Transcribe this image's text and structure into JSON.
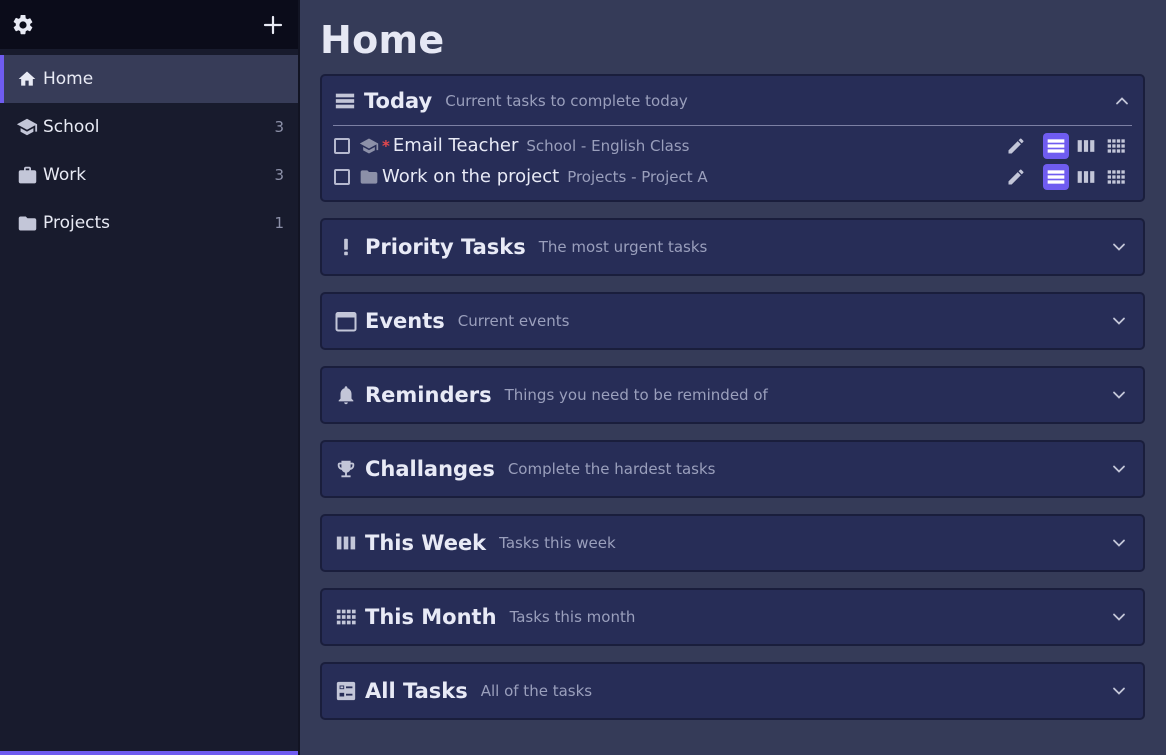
{
  "sidebar": {
    "items": [
      {
        "label": "Home",
        "count": ""
      },
      {
        "label": "School",
        "count": "3"
      },
      {
        "label": "Work",
        "count": "3"
      },
      {
        "label": "Projects",
        "count": "1"
      }
    ]
  },
  "main": {
    "title": "Home",
    "panels": [
      {
        "title": "Today",
        "subtitle": "Current tasks to complete today",
        "icon": "list-view-icon",
        "expanded": true
      },
      {
        "title": "Priority Tasks",
        "subtitle": "The most urgent tasks",
        "icon": "exclamation-icon"
      },
      {
        "title": "Events",
        "subtitle": "Current events",
        "icon": "calendar-icon"
      },
      {
        "title": "Reminders",
        "subtitle": "Things you need to be reminded of",
        "icon": "bell-icon"
      },
      {
        "title": "Challanges",
        "subtitle": "Complete the hardest tasks",
        "icon": "trophy-icon"
      },
      {
        "title": "This Week",
        "subtitle": "Tasks this week",
        "icon": "week-columns-icon"
      },
      {
        "title": "This Month",
        "subtitle": "Tasks this month",
        "icon": "month-grid-icon"
      },
      {
        "title": "All Tasks",
        "subtitle": "All of the tasks",
        "icon": "all-tasks-icon"
      }
    ],
    "today_tasks": [
      {
        "name": "Email Teacher",
        "meta": "School - English Class",
        "icon": "graduation-cap-icon",
        "priority": true
      },
      {
        "name": "Work on the project",
        "meta": "Projects - Project A",
        "icon": "folder-icon",
        "priority": false
      }
    ]
  },
  "colors": {
    "accent": "#6f5cf0",
    "background": "#353b58",
    "panel": "#272d57",
    "sidebar": "#181b2d",
    "priority_star": "#e5484d"
  }
}
